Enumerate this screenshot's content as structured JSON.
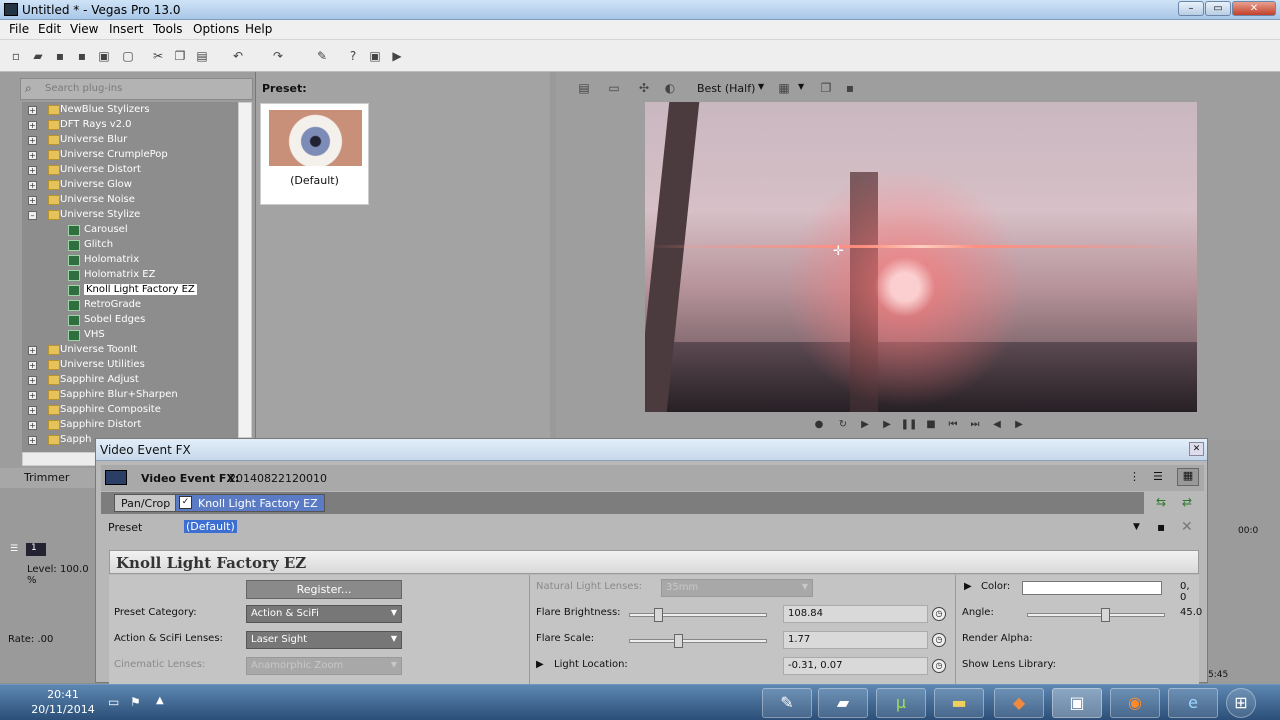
{
  "window": {
    "title": "Untitled * - Vegas Pro 13.0",
    "min": "–",
    "max": "▭",
    "close": "✕"
  },
  "menu": [
    "File",
    "Edit",
    "View",
    "Insert",
    "Tools",
    "Options",
    "Help"
  ],
  "plugins": {
    "search_placeholder": "Search plug-ins",
    "tree": [
      {
        "label": "NewBlue Stylizers",
        "type": "folder",
        "exp": "+"
      },
      {
        "label": "DFT Rays v2.0",
        "type": "folder",
        "exp": "+"
      },
      {
        "label": "Universe Blur",
        "type": "folder",
        "exp": "+"
      },
      {
        "label": "Universe CrumplePop",
        "type": "folder",
        "exp": "+"
      },
      {
        "label": "Universe Distort",
        "type": "folder",
        "exp": "+"
      },
      {
        "label": "Universe Glow",
        "type": "folder",
        "exp": "+"
      },
      {
        "label": "Universe Noise",
        "type": "folder",
        "exp": "+"
      },
      {
        "label": "Universe Stylize",
        "type": "folder",
        "exp": "–"
      },
      {
        "label": "Carousel",
        "type": "plugin"
      },
      {
        "label": "Glitch",
        "type": "plugin"
      },
      {
        "label": "Holomatrix",
        "type": "plugin"
      },
      {
        "label": "Holomatrix EZ",
        "type": "plugin"
      },
      {
        "label": "Knoll Light Factory EZ",
        "type": "plugin",
        "selected": true
      },
      {
        "label": "RetroGrade",
        "type": "plugin"
      },
      {
        "label": "Sobel Edges",
        "type": "plugin"
      },
      {
        "label": "VHS",
        "type": "plugin"
      },
      {
        "label": "Universe ToonIt",
        "type": "folder",
        "exp": "+"
      },
      {
        "label": "Universe Utilities",
        "type": "folder",
        "exp": "+"
      },
      {
        "label": "Sapphire Adjust",
        "type": "folder",
        "exp": "+"
      },
      {
        "label": "Sapphire Blur+Sharpen",
        "type": "folder",
        "exp": "+"
      },
      {
        "label": "Sapphire Composite",
        "type": "folder",
        "exp": "+"
      },
      {
        "label": "Sapphire Distort",
        "type": "folder",
        "exp": "+"
      },
      {
        "label": "Sapph",
        "type": "folder",
        "exp": "+"
      }
    ]
  },
  "trimmer": "Trimmer",
  "preset_panel": {
    "label": "Preset:",
    "thumb_caption": "(Default)"
  },
  "preview": {
    "quality": "Best (Half)"
  },
  "fx": {
    "title": "Video Event FX",
    "event_label": "Video Event FX:",
    "event_id": "20140822120010",
    "chain": [
      "Pan/Crop",
      "Knoll Light Factory EZ"
    ],
    "preset_label": "Preset",
    "preset_value": "(Default)",
    "plugin_title": "Knoll Light Factory EZ",
    "register": "Register...",
    "preset_category_label": "Preset Category:",
    "preset_category": "Action & SciFi",
    "lenses_label": "Action & SciFi Lenses:",
    "lenses": "Laser Sight",
    "cinematic_label": "Cinematic Lenses:",
    "cinematic": "Anamorphic Zoom",
    "natural_label": "Natural Light Lenses:",
    "natural": "35mm",
    "brightness_label": "Flare Brightness:",
    "brightness": "108.84",
    "scale_label": "Flare Scale:",
    "scale": "1.77",
    "location_label": "Light Location:",
    "location": "-0.31, 0.07",
    "color_label": "Color:",
    "color_value": "0, 0",
    "angle_label": "Angle:",
    "angle": "45.0",
    "render_alpha_label": "Render Alpha:",
    "show_lens_label": "Show Lens Library:"
  },
  "left_lower": {
    "track": "1",
    "level": "Level: 100.0 %",
    "rate": "Rate: .00"
  },
  "right_lower": {
    "time": "00:0",
    "time2": "5:45"
  },
  "taskbar": {
    "time": "20:41",
    "date": "20/11/2014"
  }
}
